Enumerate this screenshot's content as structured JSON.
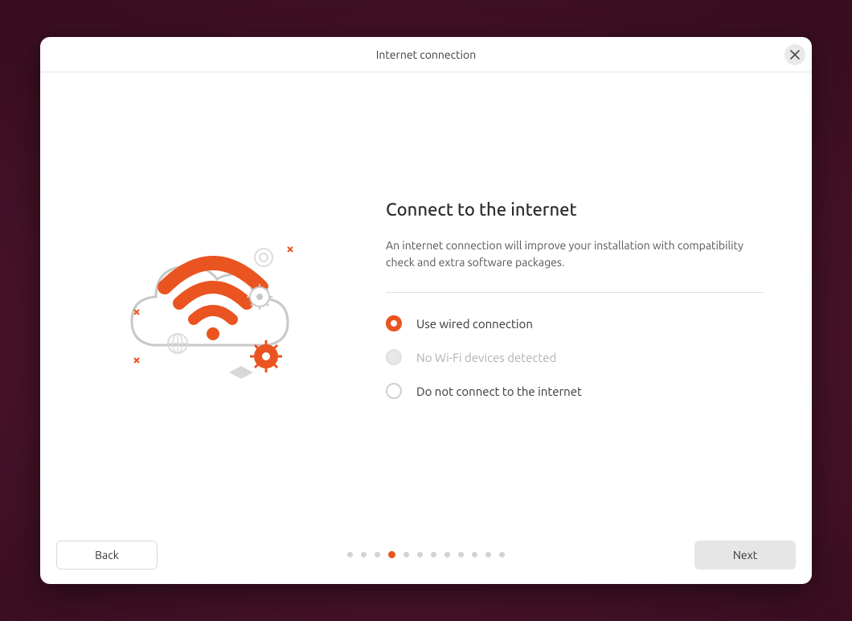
{
  "titlebar": {
    "title": "Internet connection"
  },
  "main": {
    "heading": "Connect to the internet",
    "subtext": "An internet connection will improve your installation with compatibility check and extra software packages.",
    "options": [
      {
        "label": "Use wired connection",
        "selected": true,
        "disabled": false
      },
      {
        "label": "No Wi-Fi devices detected",
        "selected": false,
        "disabled": true
      },
      {
        "label": "Do not connect to the internet",
        "selected": false,
        "disabled": false
      }
    ]
  },
  "footer": {
    "back_label": "Back",
    "next_label": "Next",
    "steps_total": 12,
    "current_step": 4
  },
  "colors": {
    "accent": "#e95420"
  }
}
